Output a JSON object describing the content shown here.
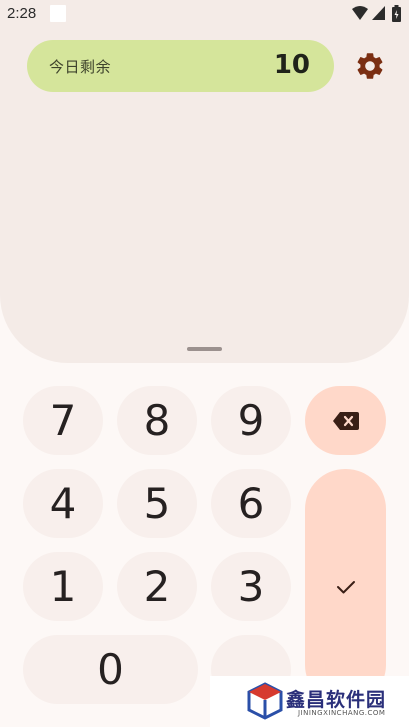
{
  "status_bar": {
    "time": "2:28"
  },
  "budget": {
    "label": "今日剩余",
    "value": "10"
  },
  "keypad": {
    "k7": "7",
    "k8": "8",
    "k9": "9",
    "k4": "4",
    "k5": "5",
    "k6": "6",
    "k1": "1",
    "k2": "2",
    "k3": "3",
    "k0": "0",
    "kdot": ""
  },
  "icons": {
    "settings": "gear-icon",
    "delete": "backspace-icon",
    "confirm": "check-icon"
  },
  "colors": {
    "top_panel": "#f4ebe7",
    "pill": "#d5e59b",
    "number_key": "#f8efec",
    "action_key": "#ffd8c9",
    "settings_icon": "#7a2e12"
  },
  "watermark": {
    "title": "鑫昌软件园",
    "subtitle": "JININGXINCHANG.COM"
  }
}
